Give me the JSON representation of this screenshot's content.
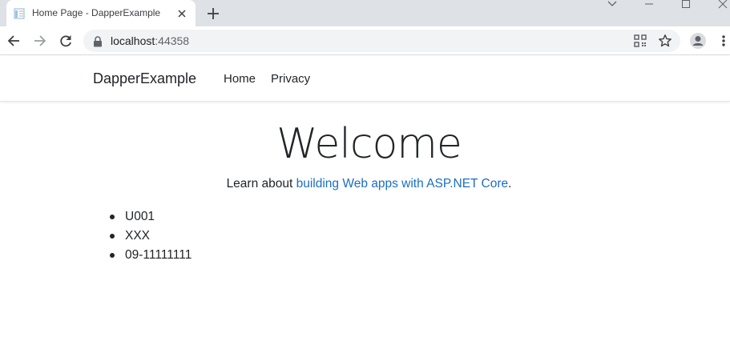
{
  "browser": {
    "tab_title": "Home Page - DapperExample",
    "url_host": "localhost",
    "url_port": ":44358"
  },
  "navbar": {
    "brand": "DapperExample",
    "links": [
      "Home",
      "Privacy"
    ]
  },
  "main": {
    "heading": "Welcome",
    "lead_prefix": "Learn about ",
    "lead_link": "building Web apps with ASP.NET Core",
    "lead_suffix": ".",
    "items": [
      "U001",
      "XXX",
      "09-11111111"
    ]
  },
  "colors": {
    "link": "#1b6ec2",
    "text": "#212529",
    "chrome_bg": "#dee1e6",
    "omnibox_bg": "#f1f3f4"
  },
  "icons": [
    "page-favicon-icon",
    "close-icon",
    "plus-icon",
    "chevron-down-icon",
    "minimize-icon",
    "maximize-icon",
    "window-close-icon",
    "back-arrow-icon",
    "forward-arrow-icon",
    "reload-icon",
    "lock-icon",
    "qr-code-icon",
    "star-icon",
    "profile-icon",
    "more-vert-icon"
  ]
}
